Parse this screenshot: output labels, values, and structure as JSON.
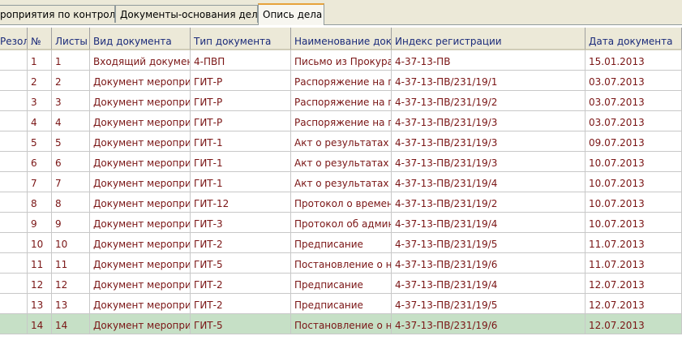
{
  "tabs": [
    {
      "label": "роприятия по контролю"
    },
    {
      "label": "Документы-основания дела"
    },
    {
      "label": "Опись дела"
    }
  ],
  "table": {
    "headers": [
      "Резолю",
      "№",
      "Листы",
      "Вид документа",
      "Тип документа",
      "Наименование документа",
      "Индекс регистрации",
      "Дата документа"
    ],
    "rows": [
      {
        "num": "1",
        "sheets": "1",
        "kind": "Входящий докумен",
        "type": "4-ПВП",
        "name": "Письмо из Прокура",
        "index": "4-37-13-ПВ",
        "date": "15.01.2013"
      },
      {
        "num": "2",
        "sheets": "2",
        "kind": "Документ меропри",
        "type": "ГИТ-Р",
        "name": "Распоряжение на п",
        "index": "4-37-13-ПВ/231/19/1",
        "date": "03.07.2013"
      },
      {
        "num": "3",
        "sheets": "3",
        "kind": "Документ меропри",
        "type": "ГИТ-Р",
        "name": "Распоряжение на п",
        "index": "4-37-13-ПВ/231/19/2",
        "date": "03.07.2013"
      },
      {
        "num": "4",
        "sheets": "4",
        "kind": "Документ меропри",
        "type": "ГИТ-Р",
        "name": "Распоряжение на п",
        "index": "4-37-13-ПВ/231/19/3",
        "date": "03.07.2013"
      },
      {
        "num": "5",
        "sheets": "5",
        "kind": "Документ меропри",
        "type": "ГИТ-1",
        "name": "Акт о результатах",
        "index": "4-37-13-ПВ/231/19/3",
        "date": "09.07.2013"
      },
      {
        "num": "6",
        "sheets": "6",
        "kind": "Документ меропри",
        "type": "ГИТ-1",
        "name": "Акт о результатах",
        "index": "4-37-13-ПВ/231/19/3",
        "date": "10.07.2013"
      },
      {
        "num": "7",
        "sheets": "7",
        "kind": "Документ меропри",
        "type": "ГИТ-1",
        "name": "Акт о результатах",
        "index": "4-37-13-ПВ/231/19/4",
        "date": "10.07.2013"
      },
      {
        "num": "8",
        "sheets": "8",
        "kind": "Документ меропри",
        "type": "ГИТ-12",
        "name": "Протокол о времен",
        "index": "4-37-13-ПВ/231/19/2",
        "date": "10.07.2013"
      },
      {
        "num": "9",
        "sheets": "9",
        "kind": "Документ меропри",
        "type": "ГИТ-3",
        "name": "Протокол об админ",
        "index": "4-37-13-ПВ/231/19/4",
        "date": "10.07.2013"
      },
      {
        "num": "10",
        "sheets": "10",
        "kind": "Документ меропри",
        "type": "ГИТ-2",
        "name": "Предписание",
        "index": "4-37-13-ПВ/231/19/5",
        "date": "11.07.2013"
      },
      {
        "num": "11",
        "sheets": "11",
        "kind": "Документ меропри",
        "type": "ГИТ-5",
        "name": "Постановление о н",
        "index": "4-37-13-ПВ/231/19/6",
        "date": "11.07.2013"
      },
      {
        "num": "12",
        "sheets": "12",
        "kind": "Документ меропри",
        "type": "ГИТ-2",
        "name": "Предписание",
        "index": "4-37-13-ПВ/231/19/4",
        "date": "12.07.2013"
      },
      {
        "num": "13",
        "sheets": "13",
        "kind": "Документ меропри",
        "type": "ГИТ-2",
        "name": "Предписание",
        "index": "4-37-13-ПВ/231/19/5",
        "date": "12.07.2013"
      },
      {
        "num": "14",
        "sheets": "14",
        "kind": "Документ меропри",
        "type": "ГИТ-5",
        "name": "Постановление о н",
        "index": "4-37-13-ПВ/231/19/6",
        "date": "12.07.2013",
        "selected": true
      }
    ]
  }
}
